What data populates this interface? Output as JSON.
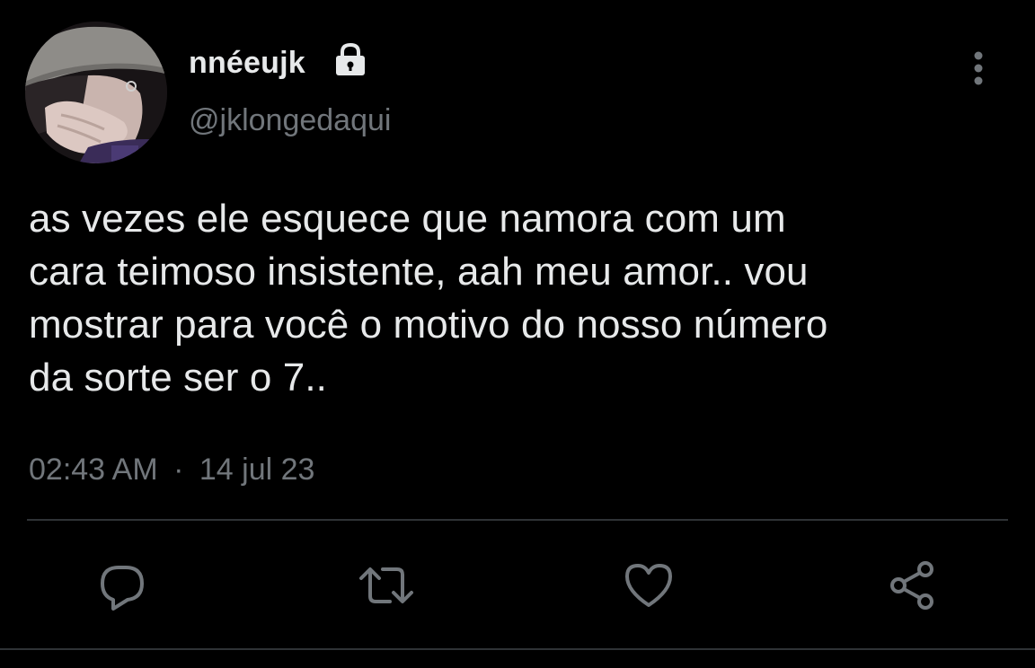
{
  "tweet": {
    "display_name": "nnéeujk",
    "handle": "@jklongedaqui",
    "protected_icon": "lock-icon",
    "avatar_icon": "profile-avatar",
    "menu_icon": "more-vertical-icon",
    "text": "as vezes ele esquece que namora com um\ncara teimoso insistente, aah meu amor.. vou\nmostrar para você o motivo do nosso número\nda sorte ser o 7..",
    "time": "02:43 AM",
    "separator": "·",
    "date": "14 jul 23"
  },
  "actions": [
    {
      "icon": "reply-icon",
      "label": "Reply"
    },
    {
      "icon": "retweet-icon",
      "label": "Retweet"
    },
    {
      "icon": "heart-icon",
      "label": "Like"
    },
    {
      "icon": "share-icon",
      "label": "Share"
    }
  ],
  "colors": {
    "background": "#000000",
    "primary_text": "#e7e9ea",
    "secondary_text": "#71767b",
    "divider": "#2f3336"
  }
}
